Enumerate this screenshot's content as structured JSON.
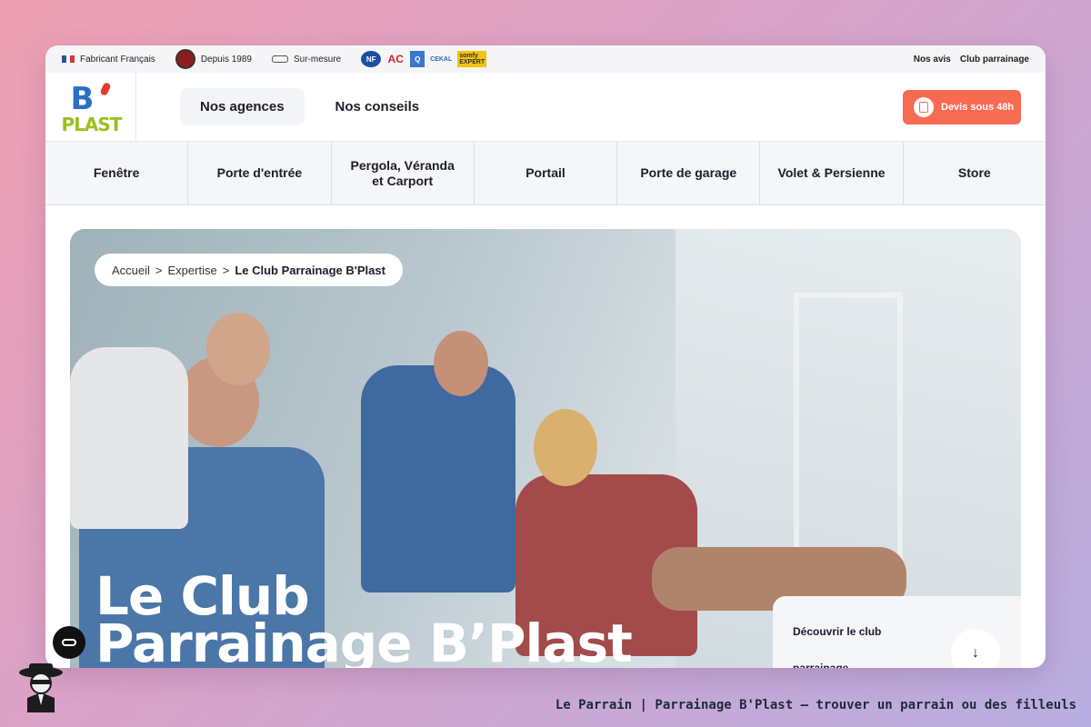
{
  "topbar": {
    "made_in": "Fabricant Français",
    "since": "Depuis 1989",
    "custom": "Sur-mesure",
    "certifications": [
      "NF",
      "AC",
      "Q",
      "CEKAL",
      "somfy EXPERT"
    ],
    "links": [
      "Nos avis",
      "Club parrainage"
    ]
  },
  "header": {
    "logo_letter": "B",
    "logo_text": "PLAST",
    "nav": [
      "Nos agences",
      "Nos conseils"
    ],
    "cta_label": "Devis sous 48h"
  },
  "categories": [
    "Fenêtre",
    "Porte d'entrée",
    "Pergola, Véranda et Carport",
    "Portail",
    "Porte de garage",
    "Volet & Persienne",
    "Store"
  ],
  "hero": {
    "breadcrumb": [
      "Accueil",
      "Expertise",
      "Le Club Parrainage B'Plast"
    ],
    "title_line1": "Le Club",
    "title_line2": "Parrainage B’Plast",
    "discover_line1": "Découvrir le club",
    "discover_line2": "parrainage"
  },
  "footer": {
    "caption": "Le Parrain | Parrainage B'Plast — trouver un parrain ou des filleuls"
  },
  "colors": {
    "cta": "#f76b52",
    "logo_blue": "#2b6fc4",
    "logo_green": "#9ac11c"
  }
}
